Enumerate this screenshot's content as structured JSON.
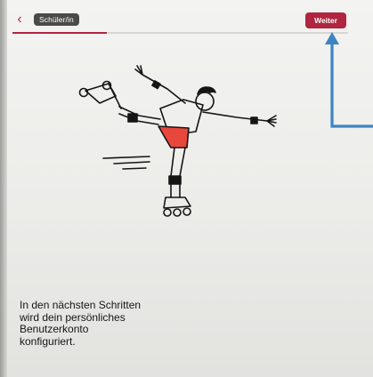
{
  "header": {
    "back_icon": "chevron-left-icon",
    "role_chip": "Schüler/in",
    "next_label": "Weiter",
    "progress": 0.28
  },
  "main": {
    "illustration": "roller-skater-illustration",
    "description": "In den nächsten Schritten\nwird dein persönliches\nBenutzerkonto\nkonfiguriert."
  },
  "colors": {
    "accent": "#b0253f",
    "chip": "#4a4a48",
    "annotation_arrow": "#3d84c2",
    "shorts": "#e8483c"
  }
}
